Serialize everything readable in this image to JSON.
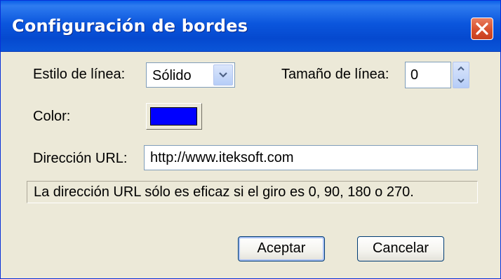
{
  "window": {
    "title": "Configuración de bordes"
  },
  "form": {
    "line_style_label": "Estilo de línea:",
    "line_style_value": "Sólido",
    "line_size_label": "Tamaño de línea:",
    "line_size_value": "0",
    "color_label": "Color:",
    "color_value": "#0000ff",
    "url_label": "Dirección URL:",
    "url_value": "http://www.iteksoft.com",
    "note": "La dirección URL sólo es eficaz si el giro es 0, 90, 180 o 270."
  },
  "buttons": {
    "ok": "Aceptar",
    "cancel": "Cancelar"
  },
  "icons": {
    "close": "close-icon",
    "dropdown": "chevron-down-icon",
    "spin_up": "chevron-up-icon",
    "spin_down": "chevron-down-icon"
  },
  "colors": {
    "titlebar": "#0549cf",
    "close_button": "#d8502d",
    "dialog_background": "#ece9d8"
  }
}
